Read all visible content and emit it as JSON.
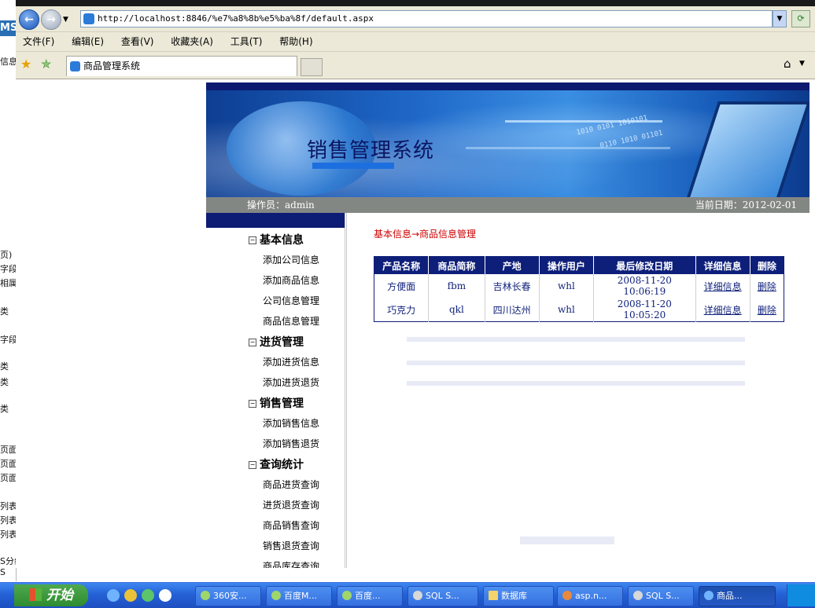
{
  "browser": {
    "url": "http://localhost:8846/%e7%a8%8b%e5%ba%8f/default.aspx",
    "menus": [
      "文件(F)",
      "编辑(E)",
      "查看(V)",
      "收藏夹(A)",
      "工具(T)",
      "帮助(H)"
    ],
    "tab_title": "商品管理系统"
  },
  "background_window": {
    "logo": "MS",
    "snippets": [
      "信息",
      "页)",
      "字段",
      "相属",
      "类",
      "字段",
      "类",
      "类",
      "类",
      "页面",
      "页面",
      "页面",
      "列表",
      "列表",
      "列表",
      "S分组",
      "S",
      "S"
    ]
  },
  "page": {
    "banner_title": "销售管理系统",
    "operator": "操作员：admin",
    "date": "当前日期：2012-02-01",
    "breadcrumb": "基本信息→商品信息管理"
  },
  "sidebar": {
    "groups": [
      {
        "title": "基本信息",
        "items": [
          "添加公司信息",
          "添加商品信息",
          "公司信息管理",
          "商品信息管理"
        ]
      },
      {
        "title": "进货管理",
        "items": [
          "添加进货信息",
          "添加进货退货"
        ]
      },
      {
        "title": "销售管理",
        "items": [
          "添加销售信息",
          "添加销售退货"
        ]
      },
      {
        "title": "查询统计",
        "items": [
          "商品进货查询",
          "进货退货查询",
          "商品销售查询",
          "销售退货查询",
          "商品库存查询"
        ]
      }
    ]
  },
  "table": {
    "columns": [
      "产品名称",
      "商品简称",
      "产地",
      "操作用户",
      "最后修改日期",
      "详细信息",
      "删除"
    ],
    "rows": [
      {
        "name": "方便面",
        "short": "fbm",
        "origin": "吉林长春",
        "user": "whl",
        "modified": "2008-11-20 10:06:19",
        "detail": "详细信息",
        "delete": "删除"
      },
      {
        "name": "巧克力",
        "short": "qkl",
        "origin": "四川达州",
        "user": "whl",
        "modified": "2008-11-20 10:05:20",
        "detail": "详细信息",
        "delete": "删除"
      }
    ]
  },
  "taskbar": {
    "start": "开始",
    "buttons": [
      "360安...",
      "百度M...",
      "百度...",
      "SQL S...",
      "数据库",
      "asp.n...",
      "SQL S...",
      "商品..."
    ]
  }
}
